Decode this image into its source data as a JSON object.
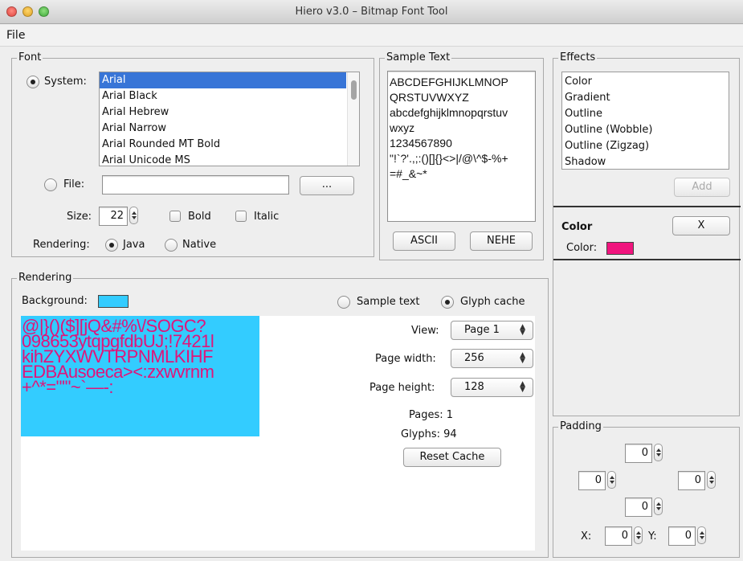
{
  "window": {
    "title": "Hiero v3.0 – Bitmap Font Tool"
  },
  "menu": {
    "file": "File"
  },
  "font_panel": {
    "legend": "Font",
    "system_label": "System:",
    "fonts": [
      "Arial",
      "Arial Black",
      "Arial Hebrew",
      "Arial Narrow",
      "Arial Rounded MT Bold",
      "Arial Unicode MS"
    ],
    "selected_font": "Arial",
    "file_label": "File:",
    "file_value": "",
    "browse_label": "...",
    "size_label": "Size:",
    "size_value": "22",
    "bold_label": "Bold",
    "italic_label": "Italic",
    "rendering_label": "Rendering:",
    "java_label": "Java",
    "native_label": "Native"
  },
  "sample_panel": {
    "legend": "Sample Text",
    "lines": [
      "ABCDEFGHIJKLMNOP",
      "QRSTUVWXYZ",
      "abcdefghijklmnopqrstuv",
      "wxyz",
      "1234567890",
      "\"!`?'.,;:()[]{}<>|/@\\^$-%+",
      "=#_&~*"
    ],
    "ascii_label": "ASCII",
    "nehe_label": "NEHE"
  },
  "effects_panel": {
    "legend": "Effects",
    "items": [
      "Color",
      "Gradient",
      "Outline",
      "Outline (Wobble)",
      "Outline (Zigzag)",
      "Shadow"
    ],
    "add_label": "Add",
    "color_title": "Color",
    "remove_label": "X",
    "color_label": "Color:",
    "color_value": "#f0157e"
  },
  "rendering_panel": {
    "legend": "Rendering",
    "background_label": "Background:",
    "background_color": "#33ccff",
    "sample_text_label": "Sample text",
    "glyph_cache_label": "Glyph cache",
    "view_label": "View:",
    "view_value": "Page 1",
    "page_width_label": "Page width:",
    "page_width_value": "256",
    "page_height_label": "Page height:",
    "page_height_value": "128",
    "pages_text": "Pages: 1",
    "glyphs_text": "Glyphs: 94",
    "reset_label": "Reset Cache",
    "glyph_rows": [
      "@|}()($][jQ&#%\\/SOGC?",
      "098653ytqpgfdbUJ;!7421l",
      "kihZYXWVTRPNMLKIHF",
      "EDBAusoeca><:zxwvrnm",
      "+^*=\"'\"~`—-:"
    ],
    "glyph_color": "#e0157a"
  },
  "padding_panel": {
    "legend": "Padding",
    "top": "0",
    "left": "0",
    "right": "0",
    "bottom": "0",
    "x_label": "X:",
    "x_value": "0",
    "y_label": "Y:",
    "y_value": "0"
  }
}
